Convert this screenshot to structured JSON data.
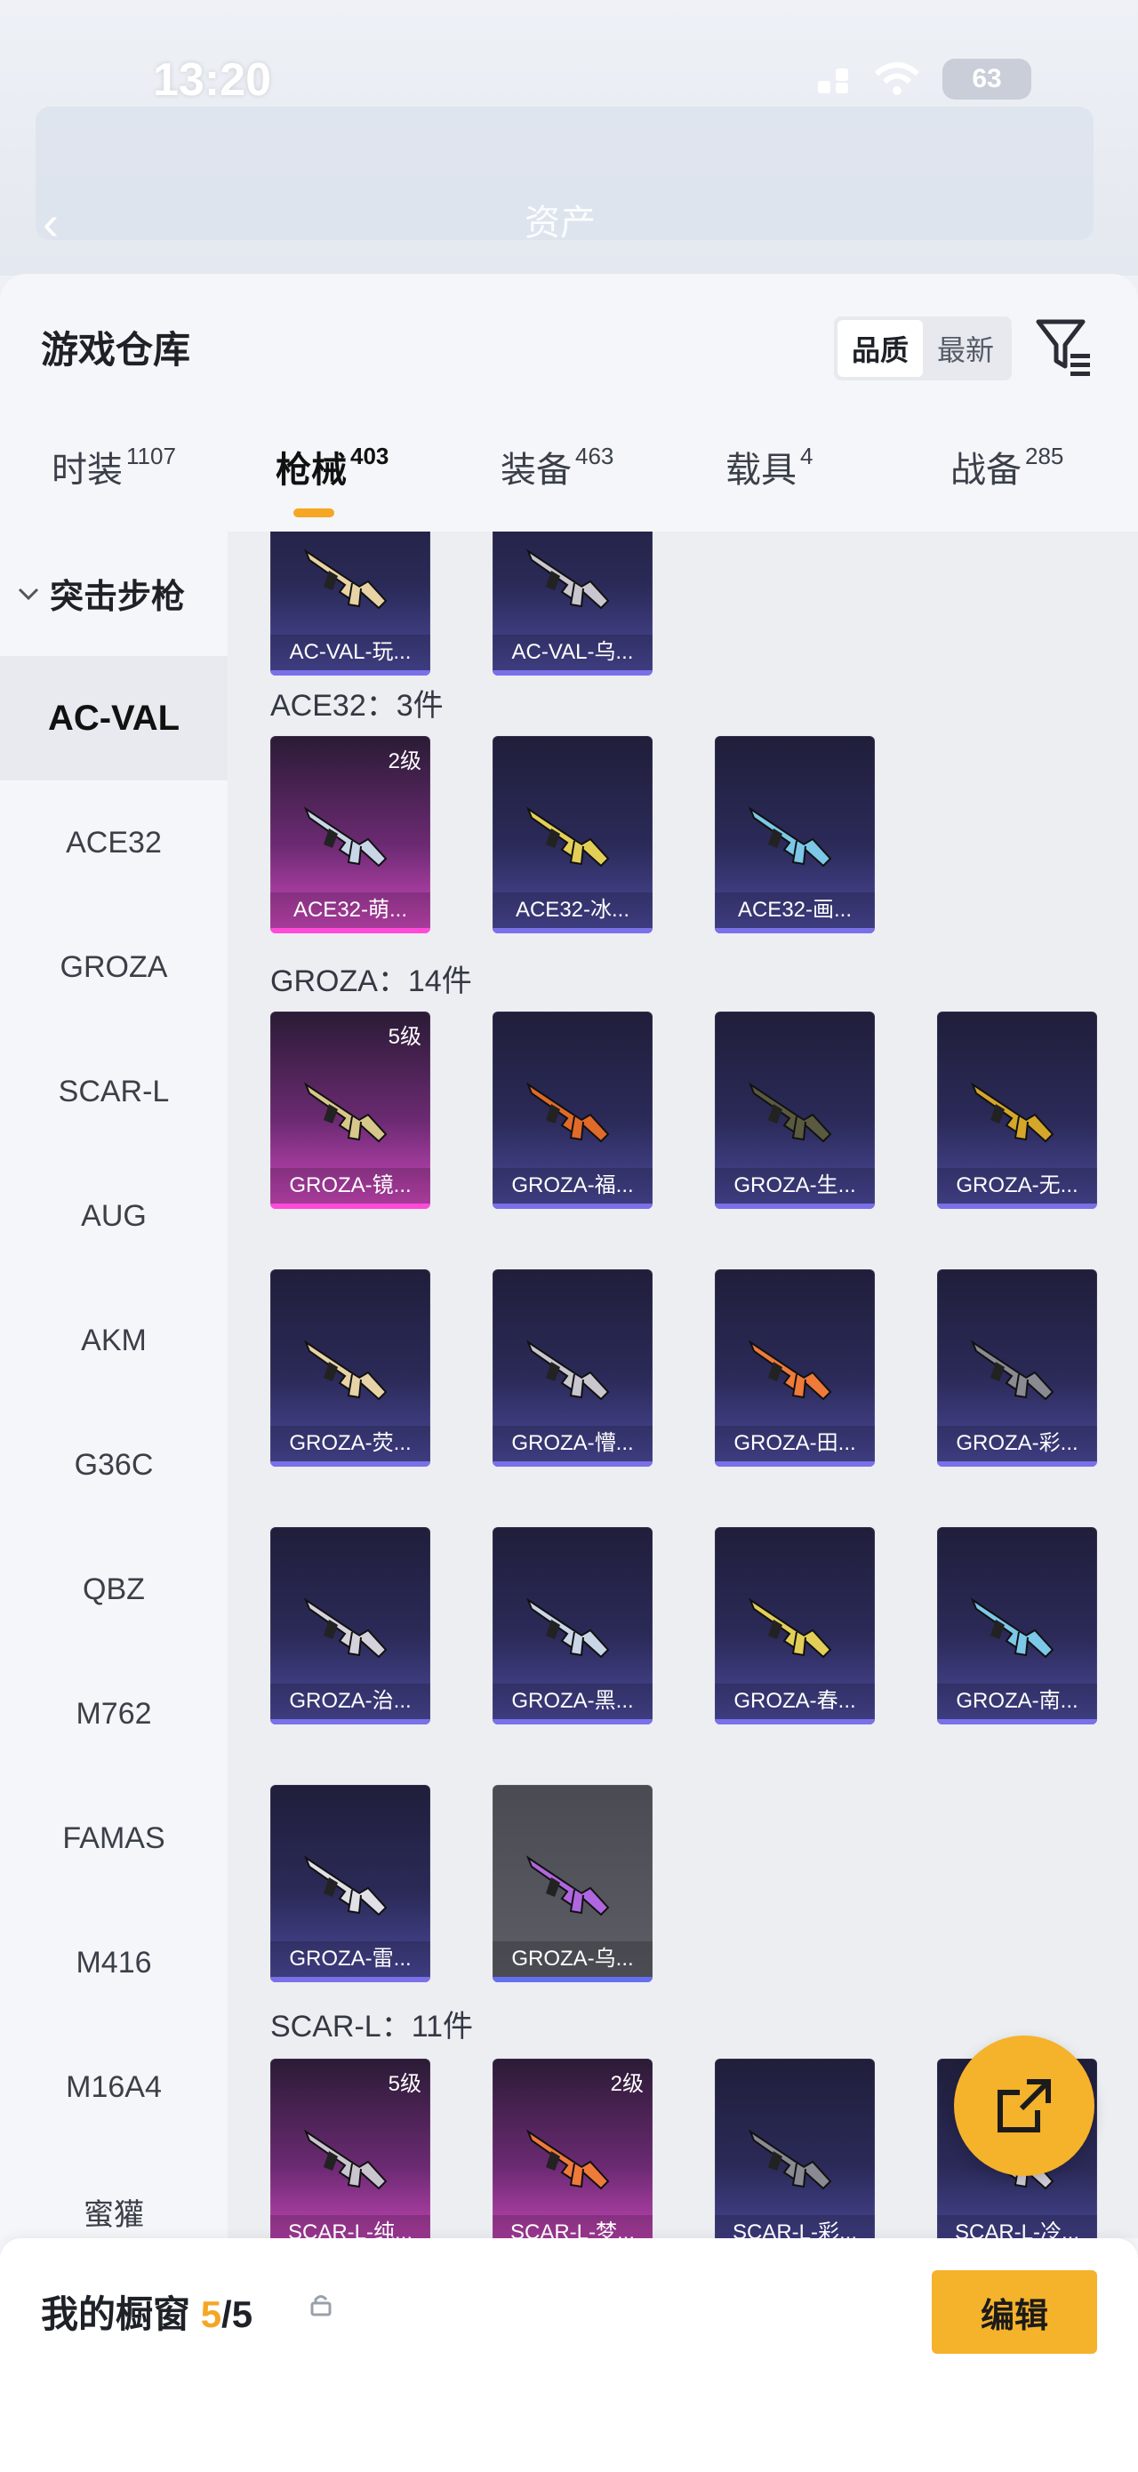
{
  "status": {
    "time": "13:20",
    "battery": "63"
  },
  "background": {
    "title": "资产"
  },
  "header": {
    "title": "游戏仓库",
    "sort_options": [
      "品质",
      "最新"
    ],
    "sort_active": "品质"
  },
  "tabs": [
    {
      "label": "时装",
      "count": "1107"
    },
    {
      "label": "枪械",
      "count": "403"
    },
    {
      "label": "装备",
      "count": "463"
    },
    {
      "label": "载具",
      "count": "4"
    },
    {
      "label": "战备",
      "count": "285"
    }
  ],
  "sidebar": {
    "category": "突击步枪",
    "items": [
      "AC-VAL",
      "ACE32",
      "GROZA",
      "SCAR-L",
      "AUG",
      "AKM",
      "G36C",
      "QBZ",
      "M762",
      "FAMAS",
      "M416",
      "M16A4",
      "蜜獾"
    ],
    "active": "AC-VAL"
  },
  "groups": [
    {
      "label": "",
      "items": [
        {
          "name": "AC-VAL-玩...",
          "level": "",
          "tier": "blue"
        },
        {
          "name": "AC-VAL-乌...",
          "level": "",
          "tier": "blue"
        }
      ]
    },
    {
      "label": "ACE32：3件",
      "items": [
        {
          "name": "ACE32-萌...",
          "level": "2级",
          "tier": "pink"
        },
        {
          "name": "ACE32-冰...",
          "level": "",
          "tier": "blue"
        },
        {
          "name": "ACE32-画...",
          "level": "",
          "tier": "blue"
        }
      ]
    },
    {
      "label": "GROZA：14件",
      "items": [
        {
          "name": "GROZA-镜...",
          "level": "5级",
          "tier": "pink"
        },
        {
          "name": "GROZA-福...",
          "level": "",
          "tier": "blue"
        },
        {
          "name": "GROZA-生...",
          "level": "",
          "tier": "blue"
        },
        {
          "name": "GROZA-无...",
          "level": "",
          "tier": "blue"
        },
        {
          "name": "GROZA-荧...",
          "level": "",
          "tier": "blue"
        },
        {
          "name": "GROZA-懵...",
          "level": "",
          "tier": "blue"
        },
        {
          "name": "GROZA-田...",
          "level": "",
          "tier": "blue"
        },
        {
          "name": "GROZA-彩...",
          "level": "",
          "tier": "blue"
        },
        {
          "name": "GROZA-治...",
          "level": "",
          "tier": "blue"
        },
        {
          "name": "GROZA-黑...",
          "level": "",
          "tier": "blue"
        },
        {
          "name": "GROZA-春...",
          "level": "",
          "tier": "blue"
        },
        {
          "name": "GROZA-南...",
          "level": "",
          "tier": "blue"
        },
        {
          "name": "GROZA-雷...",
          "level": "",
          "tier": "blue"
        },
        {
          "name": "GROZA-乌...",
          "level": "",
          "tier": "gray"
        }
      ]
    },
    {
      "label": "SCAR-L：11件",
      "items": [
        {
          "name": "SCAR-L-纯...",
          "level": "5级",
          "tier": "pink"
        },
        {
          "name": "SCAR-L-梦...",
          "level": "2级",
          "tier": "pink"
        },
        {
          "name": "SCAR-L-彩...",
          "level": "",
          "tier": "blue"
        },
        {
          "name": "SCAR-L-冷...",
          "level": "",
          "tier": "blue"
        }
      ]
    }
  ],
  "showcase": {
    "label": "我的橱窗",
    "current": "5",
    "total": "/5",
    "edit_label": "编辑"
  },
  "colors": {
    "accent": "#f5a623",
    "fab": "#f5b22b",
    "pink_tier": "#d24ac0",
    "blue_tier": "#4d4b9e"
  }
}
